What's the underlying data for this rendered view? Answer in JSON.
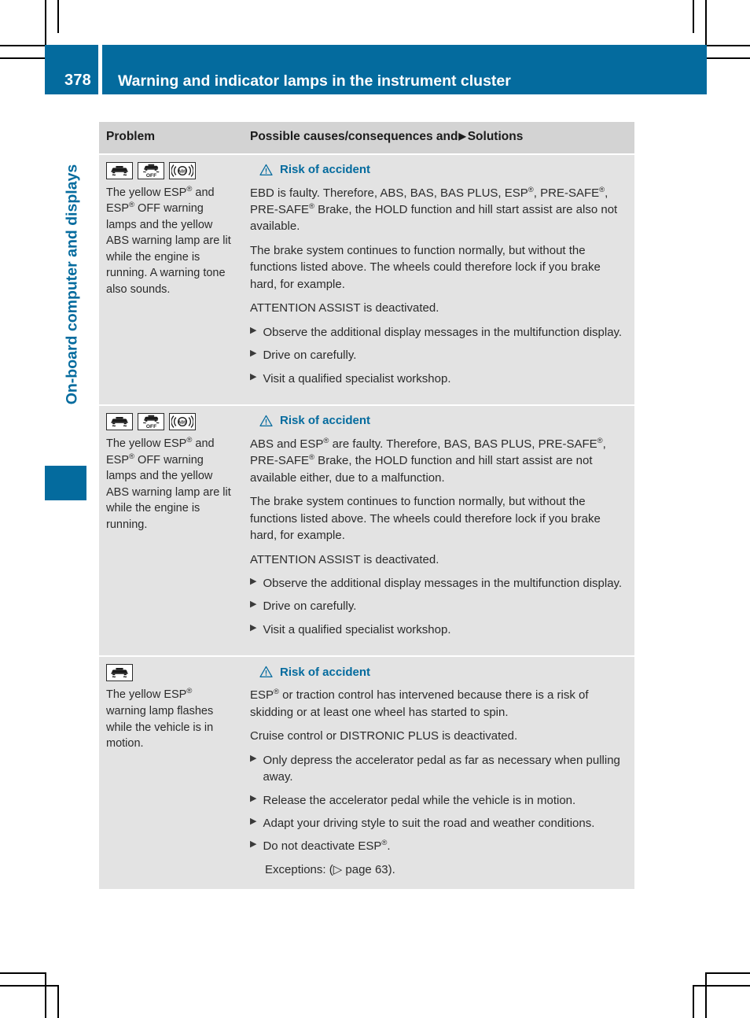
{
  "colors": {
    "brand": "#046b9e",
    "header_row_bg": "#d3d3d3",
    "row_bg": "#e3e3e3"
  },
  "header": {
    "page_number": "378",
    "title": "Warning and indicator lamps in the instrument cluster"
  },
  "sidebar": {
    "chapter_label": "On-board computer and displays"
  },
  "table": {
    "columns": {
      "problem": "Problem",
      "solutions_pre": "Possible causes/consequences and",
      "solutions_arrow": "▶",
      "solutions_post": "Solutions"
    },
    "rows": [
      {
        "lamps": [
          "esp-skid-icon",
          "esp-off-icon",
          "abs-icon"
        ],
        "problem_text_parts": [
          "The yellow ESP",
          "®",
          " and ESP",
          "®",
          " OFF warning lamps and the yellow ABS warning lamp are lit while the engine is running. A warning tone also sounds."
        ],
        "warning_title": "Risk of accident",
        "paragraphs": [
          "EBD is faulty. Therefore, ABS, BAS, BAS PLUS, ESP®, PRE-SAFE®, PRE-SAFE® Brake, the HOLD function and hill start assist are also not available.",
          "The brake system continues to function normally, but without the functions listed above. The wheels could therefore lock if you brake hard, for example.",
          "ATTENTION ASSIST is deactivated."
        ],
        "bullets": [
          "Observe the additional display messages in the multifunction display.",
          "Drive on carefully.",
          "Visit a qualified specialist workshop."
        ]
      },
      {
        "lamps": [
          "esp-skid-icon",
          "esp-off-icon",
          "abs-icon"
        ],
        "problem_text_parts": [
          "The yellow ESP",
          "®",
          " and ESP",
          "®",
          " OFF warning lamps and the yellow ABS warning lamp are lit while the engine is running."
        ],
        "warning_title": "Risk of accident",
        "paragraphs": [
          "ABS and ESP® are faulty. Therefore, BAS, BAS PLUS, PRE-SAFE®, PRE-SAFE® Brake, the HOLD function and hill start assist are not available either, due to a malfunction.",
          "The brake system continues to function normally, but without the functions listed above. The wheels could therefore lock if you brake hard, for example.",
          "ATTENTION ASSIST is deactivated."
        ],
        "bullets": [
          "Observe the additional display messages in the multifunction display.",
          "Drive on carefully.",
          "Visit a qualified specialist workshop."
        ]
      },
      {
        "lamps": [
          "esp-skid-icon"
        ],
        "problem_text_parts": [
          "The yellow ESP",
          "®",
          " warning lamp flashes while the vehicle is in motion."
        ],
        "warning_title": "Risk of accident",
        "paragraphs": [
          "ESP® or traction control has intervened because there is a risk of skidding or at least one wheel has started to spin.",
          "Cruise control or DISTRONIC PLUS is deactivated."
        ],
        "bullets": [
          "Only depress the accelerator pedal as far as necessary when pulling away.",
          "Release the accelerator pedal while the vehicle is in motion.",
          "Adapt your driving style to suit the road and weather conditions.",
          "Do not deactivate ESP®."
        ],
        "sub_note": "Exceptions: (▷ page 63)."
      }
    ]
  }
}
